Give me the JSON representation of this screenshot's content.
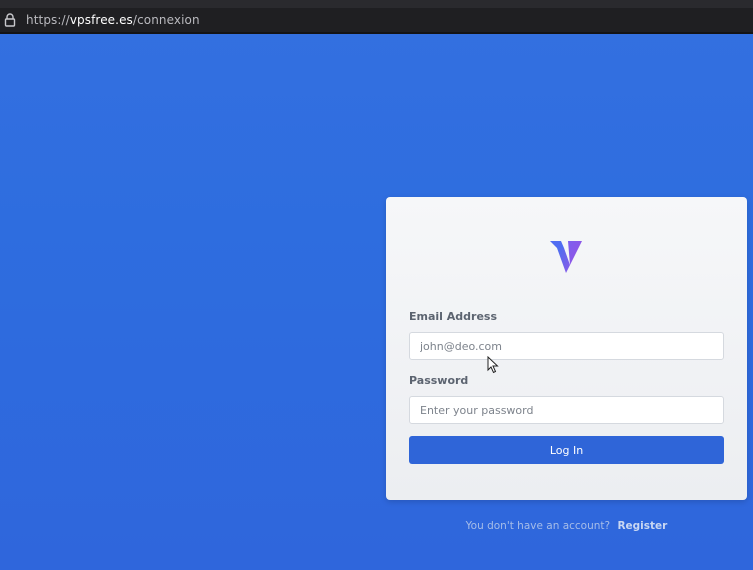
{
  "browser": {
    "url_prefix": "https://",
    "url_host": "vpsfree.es",
    "url_path": "/connexion",
    "lock_icon": "lock-icon"
  },
  "login_form": {
    "logo_icon": "v-logo-icon",
    "email_label": "Email Address",
    "email_value": "",
    "email_placeholder": "john@deo.com",
    "password_label": "Password",
    "password_value": "",
    "password_placeholder": "Enter your password",
    "login_button_label": "Log In"
  },
  "footer": {
    "no_account_text": "You don't have an account?",
    "register_label": "Register"
  },
  "colors": {
    "background": "#3470e0",
    "button": "#2f65d8",
    "logo_gradient_start": "#4a6ff0",
    "logo_gradient_end": "#8a5ae8"
  }
}
